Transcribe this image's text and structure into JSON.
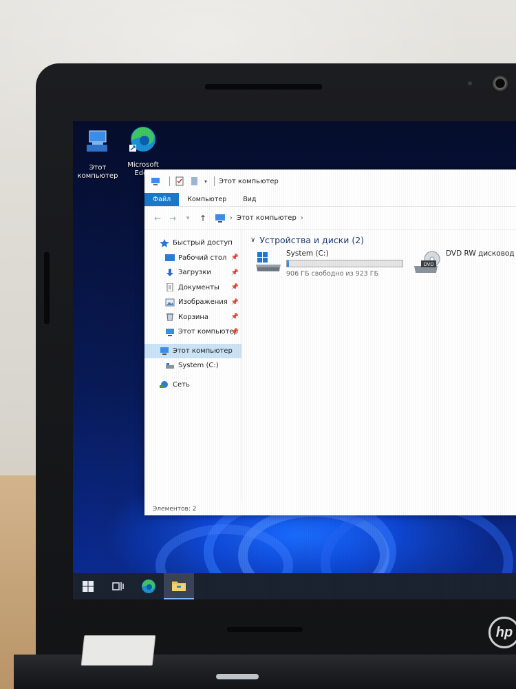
{
  "desktop": {
    "icons": [
      {
        "icon": "this-pc-icon",
        "label_line1": "Этот",
        "label_line2": "компьютер"
      },
      {
        "icon": "edge-icon",
        "label_line1": "Microsoft",
        "label_line2": "Edge"
      }
    ]
  },
  "window": {
    "title": "Этот компьютер",
    "ribbon_tabs": [
      "Файл",
      "Компьютер",
      "Вид"
    ],
    "address": {
      "crumb": "Этот компьютер",
      "separator": "›"
    },
    "nav_pane": {
      "items": [
        {
          "label": "Быстрый доступ",
          "icon": "star-icon",
          "pinned": false
        },
        {
          "label": "Рабочий стол",
          "icon": "desktop-folder-icon",
          "pinned": true
        },
        {
          "label": "Загрузки",
          "icon": "download-arrow-icon",
          "pinned": true
        },
        {
          "label": "Документы",
          "icon": "documents-icon",
          "pinned": true
        },
        {
          "label": "Изображения",
          "icon": "pictures-icon",
          "pinned": true
        },
        {
          "label": "Корзина",
          "icon": "recycle-bin-icon",
          "pinned": true
        },
        {
          "label": "Этот компьютер",
          "icon": "this-pc-icon",
          "pinned": true
        }
      ],
      "this_pc": "Этот компьютер",
      "system_drive": "System (C:)",
      "network": "Сеть"
    },
    "group_header": "Устройства и диски (2)",
    "drives": [
      {
        "name": "System (C:)",
        "free_text": "906 ГБ свободно из 923 ГБ",
        "used_fraction": 0.02
      },
      {
        "name": "DVD RW дисковод (E",
        "badge": "DVD"
      }
    ],
    "status": "Элементов: 2"
  },
  "colors": {
    "accent": "#1979ca",
    "selection": "#cce4f7",
    "taskbar": "#1b2230"
  },
  "taskbar": {
    "buttons": [
      "windows-start-icon",
      "task-view-icon",
      "edge-icon",
      "file-explorer-icon"
    ]
  },
  "device": {
    "logo": "hp"
  }
}
